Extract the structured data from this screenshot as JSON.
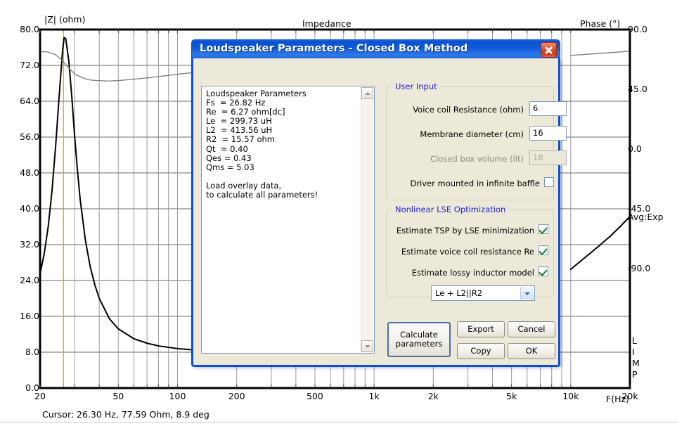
{
  "chart_data": {
    "type": "line",
    "title": "Impedance",
    "xlabel": "F(Hz)",
    "ylabel": "|Z| (ohm)",
    "y2label": "Phase (°)",
    "xscale": "log",
    "xlim": [
      20,
      20000
    ],
    "xticks": [
      "20",
      "50",
      "100",
      "200",
      "500",
      "1k",
      "2k",
      "5k",
      "10k",
      "20k"
    ],
    "xtick_values": [
      20,
      50,
      100,
      200,
      500,
      1000,
      2000,
      5000,
      10000,
      20000
    ],
    "ylim": [
      0.0,
      80.0
    ],
    "yticks": [
      "0.0",
      "8.0",
      "16.0",
      "24.0",
      "32.0",
      "40.0",
      "48.0",
      "56.0",
      "64.0",
      "72.0",
      "80.0"
    ],
    "y2lim": [
      -180.0,
      90.0
    ],
    "y2ticks": [
      "90.0",
      "45.0",
      "0.0",
      "-45.0",
      "-90.0"
    ],
    "y2tick_values": [
      90.0,
      45.0,
      0.0,
      -45.0,
      -90.0
    ],
    "grid": true,
    "legend": [
      "Avg:Exp"
    ],
    "annotations": [
      "Avg:Exp",
      "LIMP"
    ],
    "cursor_marker_hz": 26.3,
    "series": [
      {
        "name": "|Z| magnitude",
        "color": "#000000",
        "axis": "left",
        "points": [
          [
            20,
            25.5
          ],
          [
            21,
            30.0
          ],
          [
            22,
            36.0
          ],
          [
            23,
            44.0
          ],
          [
            24,
            54.0
          ],
          [
            25,
            65.0
          ],
          [
            26,
            75.0
          ],
          [
            26.5,
            78.2
          ],
          [
            27,
            78.0
          ],
          [
            28,
            73.0
          ],
          [
            29,
            65.0
          ],
          [
            30,
            56.0
          ],
          [
            31,
            48.5
          ],
          [
            32,
            42.0
          ],
          [
            34,
            33.0
          ],
          [
            36,
            27.0
          ],
          [
            38,
            23.0
          ],
          [
            40,
            20.0
          ],
          [
            45,
            15.5
          ],
          [
            50,
            13.2
          ],
          [
            60,
            11.0
          ],
          [
            70,
            10.0
          ],
          [
            80,
            9.4
          ],
          [
            100,
            8.8
          ],
          [
            130,
            8.4
          ],
          [
            170,
            8.2
          ],
          [
            200,
            8.2
          ]
        ]
      },
      {
        "name": "Phase",
        "color": "#808080",
        "axis": "right",
        "points": [
          [
            20,
            73.5
          ],
          [
            22,
            73.0
          ],
          [
            24,
            71.0
          ],
          [
            26,
            66.5
          ],
          [
            28,
            61.0
          ],
          [
            30,
            56.5
          ],
          [
            33,
            53.5
          ],
          [
            36,
            52.0
          ],
          [
            40,
            51.5
          ],
          [
            45,
            51.2
          ],
          [
            50,
            51.6
          ],
          [
            60,
            52.6
          ],
          [
            70,
            53.6
          ],
          [
            85,
            55.0
          ],
          [
            100,
            56.3
          ],
          [
            130,
            58.2
          ],
          [
            170,
            60.0
          ],
          [
            200,
            61.2
          ]
        ]
      },
      {
        "name": "Phase (high freq)",
        "color": "#808080",
        "axis": "right",
        "points": [
          [
            10000,
            70.5
          ],
          [
            12000,
            71.3
          ],
          [
            14000,
            72.0
          ],
          [
            16000,
            72.6
          ],
          [
            18000,
            73.2
          ],
          [
            20000,
            73.8
          ]
        ]
      },
      {
        "name": "|Z| (high freq)",
        "color": "#000000",
        "axis": "left",
        "points": [
          [
            10000,
            26.5
          ],
          [
            11000,
            28.0
          ],
          [
            12500,
            30.0
          ],
          [
            14000,
            31.8
          ],
          [
            16000,
            34.0
          ],
          [
            18000,
            36.2
          ],
          [
            20000,
            38.3
          ]
        ]
      }
    ]
  },
  "status": {
    "cursor_text": "Cursor: 26.30 Hz, 77.59 Ohm, 8.9 deg"
  },
  "dialog": {
    "title": "Loudspeaker Parameters - Closed Box Method",
    "close_icon": "close-icon",
    "output": "Loudspeaker Parameters\nFs  = 26.82 Hz\nRe  = 6.27 ohm[dc]\nLe  = 299.73 uH\nL2  = 413.56 uH\nR2  = 15.57 ohm\nQt  = 0.40\nQes = 0.43\nQms = 5.03\n\nLoad overlay data,\nto calculate all parameters!",
    "user_input": {
      "legend": "User Input",
      "voice_coil_label": "Voice coil Resistance (ohm)",
      "voice_coil_value": "6",
      "membrane_label": "Membrane diameter (cm)",
      "membrane_value": "16",
      "box_volume_label": "Closed box volume (lit)",
      "box_volume_value": "18",
      "baffle_label": "Driver mounted in infinite baffle",
      "baffle_checked": false
    },
    "lse": {
      "legend": "Nonlinear LSE Optimization",
      "tsp_label": "Estimate TSP by LSE minimization",
      "tsp_checked": true,
      "re_label": "Estimate voice coil resistance Re",
      "re_checked": true,
      "inductor_label": "Estimate lossy inductor model",
      "inductor_checked": true,
      "model_selected": "Le + L2||R2"
    },
    "buttons": {
      "calculate": "Calculate\nparameters",
      "calculate_line1": "Calculate",
      "calculate_line2": "parameters",
      "export": "Export",
      "cancel": "Cancel",
      "copy": "Copy",
      "ok": "OK"
    }
  },
  "colors": {
    "titlebar_blue": "#0a52d0",
    "dialog_face": "#ece9d8",
    "legend_blue": "#2222cc",
    "grid_gray": "#9a9a9a",
    "curve_black": "#000000",
    "curve_gray": "#808080",
    "cursor_yellow": "#c8b400",
    "close_red": "#cf3518",
    "check_green": "#1b7a2e"
  }
}
